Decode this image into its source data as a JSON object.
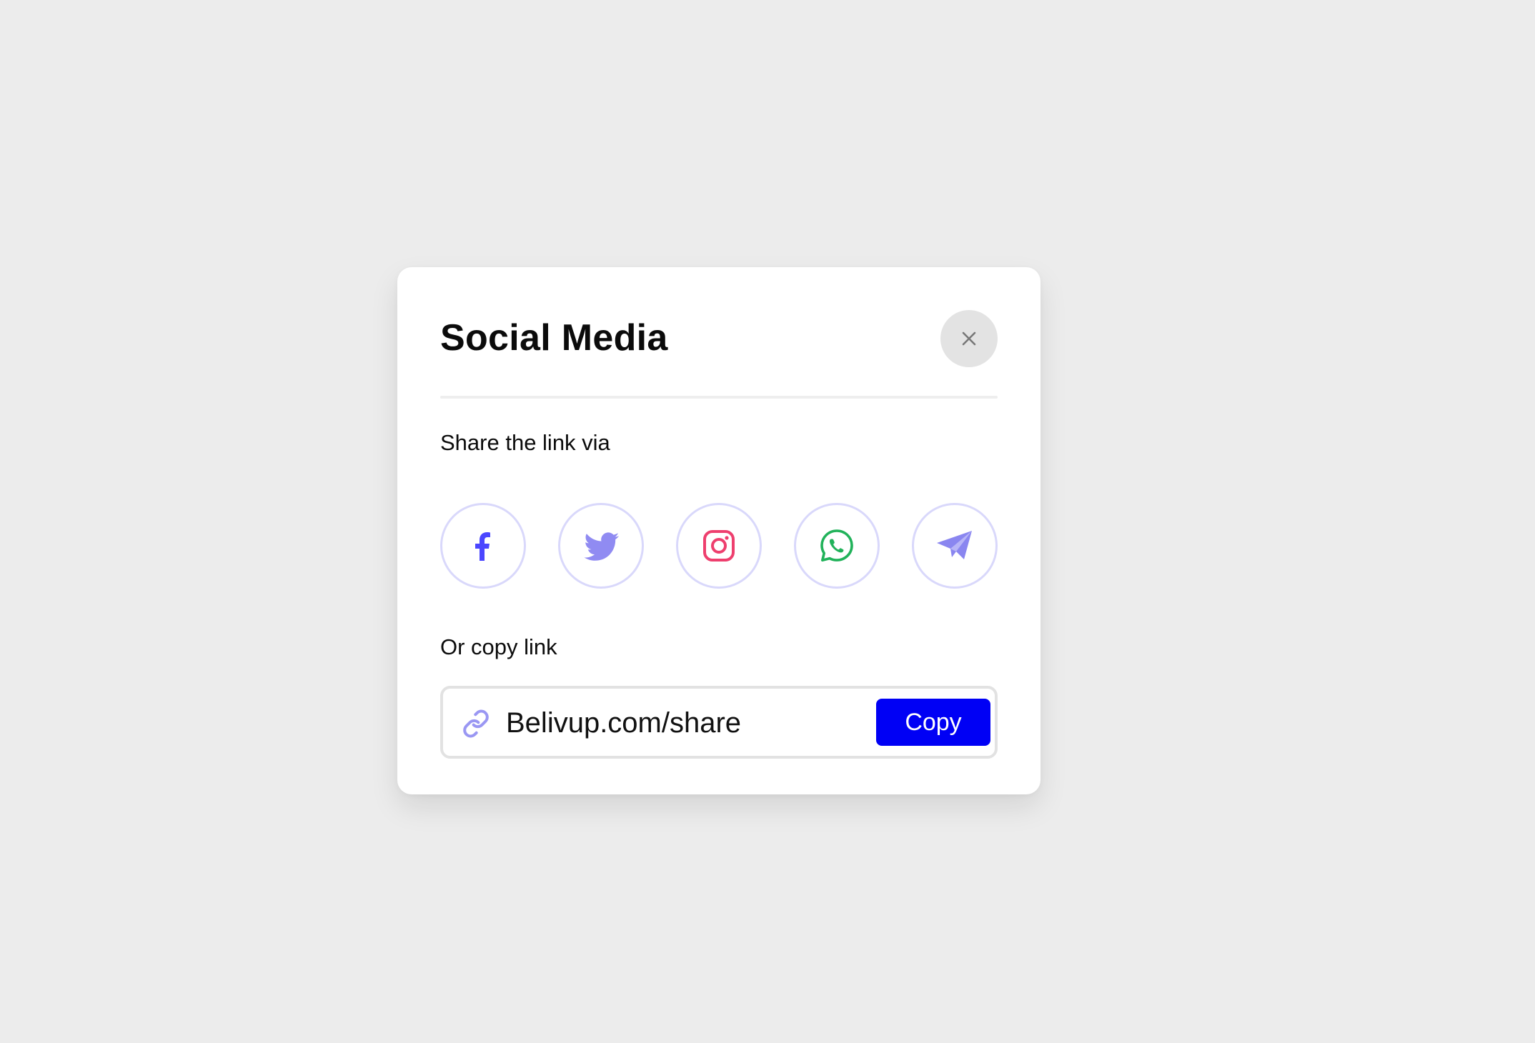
{
  "modal": {
    "title": "Social Media",
    "close_icon": "close-icon",
    "share_label": "Share the link via",
    "copy_label": "Or copy link"
  },
  "social": [
    {
      "name": "facebook",
      "icon": "facebook-icon",
      "color": "#4b46ff"
    },
    {
      "name": "twitter",
      "icon": "twitter-icon",
      "color": "#908bf2"
    },
    {
      "name": "instagram",
      "icon": "instagram-icon",
      "color": "#ee3f6e"
    },
    {
      "name": "whatsapp",
      "icon": "whatsapp-icon",
      "color": "#21b25a"
    },
    {
      "name": "telegram",
      "icon": "telegram-icon",
      "color": "#8a86f0"
    }
  ],
  "link": {
    "value": "Belivup.com/share",
    "icon": "link-icon",
    "copy_label": "Copy"
  },
  "colors": {
    "background": "#ececec",
    "accent": "#0000f5",
    "social_border": "#d9d8fb"
  }
}
